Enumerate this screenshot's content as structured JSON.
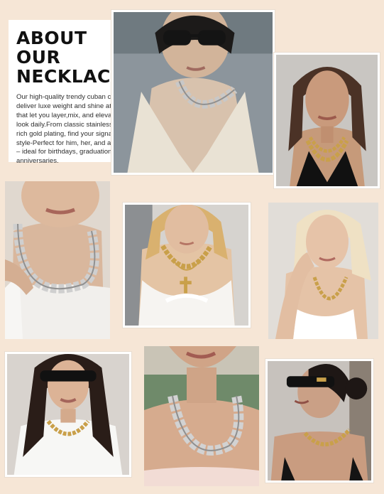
{
  "about": {
    "title_line1": "ABOUT OUR",
    "title_line2": "NECKLACES",
    "body": "Our high-quality trendy cuban chain deliver luxe weight and shine at prices that let you layer,mix, and elevate your look daily.From classic stainless steel to rich gold plating, find your signatur style-Perfect for him, her, and all styles – ideal for birthdays, graduations, anniversaries."
  },
  "colors": {
    "background": "#f6e6d6",
    "gold_chain": "#c9a04a",
    "silver_chain": "#c8c8c8",
    "text": "#2e2e2e"
  },
  "photos": [
    {
      "name": "photo-silver-chain-sunglasses",
      "chain": "silver"
    },
    {
      "name": "photo-gold-layered-chains",
      "chain": "gold"
    },
    {
      "name": "photo-silver-chain-closeup",
      "chain": "silver"
    },
    {
      "name": "photo-gold-chain-cross",
      "chain": "gold"
    },
    {
      "name": "photo-gold-chain-blonde",
      "chain": "gold"
    },
    {
      "name": "photo-gold-chain-sunglasses",
      "chain": "gold"
    },
    {
      "name": "photo-silver-chain-strapless",
      "chain": "silver"
    },
    {
      "name": "photo-gold-chain-bun",
      "chain": "gold"
    }
  ]
}
